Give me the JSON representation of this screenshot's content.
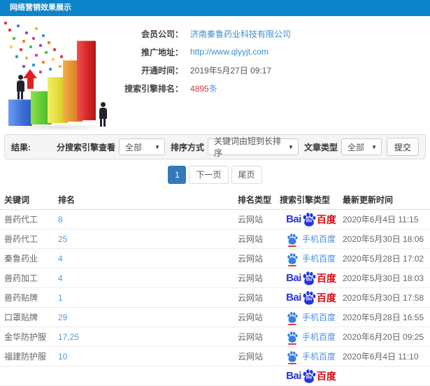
{
  "window": {
    "title": "网络营销效果展示"
  },
  "info": {
    "rows": [
      {
        "label": "会员公司：",
        "value": "济南秦鲁药业科技有限公司",
        "style": "link"
      },
      {
        "label": "推广地址：",
        "value": "http://www.qlyyjt.com",
        "style": "link"
      },
      {
        "label": "开通时间：",
        "value": "2019年5月27日 09:17",
        "style": "text"
      },
      {
        "label": "搜索引擎排名：",
        "value": "4895",
        "suffix": "条",
        "style": "highlight"
      }
    ]
  },
  "filters": {
    "section_label": "结果:",
    "groups": [
      {
        "name": "engine-filter",
        "label": "分搜索引擎查看",
        "value": "全部"
      },
      {
        "name": "sort-order",
        "label": "排序方式",
        "value": "关键词由短到长排序"
      },
      {
        "name": "article-type",
        "label": "文章类型",
        "value": "全部"
      }
    ],
    "submit_label": "提交"
  },
  "pagination": {
    "items": [
      {
        "label": "1",
        "active": true
      },
      {
        "label": "下一页",
        "active": false
      },
      {
        "label": "尾页",
        "active": false
      }
    ]
  },
  "table": {
    "columns": [
      "关键词",
      "排名",
      "排名类型",
      "搜索引擎类型",
      "最新更新时间"
    ],
    "rows": [
      {
        "keyword": "兽药代工",
        "rank": "8",
        "rank_type": "云网站",
        "engine": "baidu",
        "updated": "2020年6月4日 11:15"
      },
      {
        "keyword": "兽药代工",
        "rank": "25",
        "rank_type": "云网站",
        "engine": "mobile",
        "updated": "2020年5月30日 18:06"
      },
      {
        "keyword": "秦鲁药业",
        "rank": "4",
        "rank_type": "云网站",
        "engine": "mobile",
        "updated": "2020年5月28日 17:02"
      },
      {
        "keyword": "兽药加工",
        "rank": "4",
        "rank_type": "云网站",
        "engine": "baidu",
        "updated": "2020年5月30日 18:03"
      },
      {
        "keyword": "兽药贴牌",
        "rank": "1",
        "rank_type": "云网站",
        "engine": "baidu",
        "updated": "2020年5月30日 17:58"
      },
      {
        "keyword": "口罩贴牌",
        "rank": "29",
        "rank_type": "云网站",
        "engine": "mobile",
        "updated": "2020年5月28日 16:55"
      },
      {
        "keyword": "金华防护服",
        "rank": "17,25",
        "rank_type": "云网站",
        "engine": "mobile",
        "updated": "2020年6月20日 09:25"
      },
      {
        "keyword": "福建防护服",
        "rank": "10",
        "rank_type": "云网站",
        "engine": "mobile",
        "updated": "2020年6月4日 11:10"
      },
      {
        "keyword": "",
        "rank": "",
        "rank_type": "",
        "engine": "baidu",
        "updated": "",
        "partial": true
      }
    ]
  },
  "engines": {
    "baidu": {
      "prefix": "Bai",
      "paw_text": "du",
      "suffix": "百度"
    },
    "mobile": {
      "label": "手机百度"
    }
  },
  "colors": {
    "titlebar_blue": "#0b84ca",
    "link_blue": "#3c8dcc",
    "rank_blue": "#4f9be0",
    "count_red": "#e4393c",
    "count_suffix_blue": "#4f9be0",
    "baidu_blue": "#2534dc",
    "baidu_red": "#dd0b12",
    "mobile_baidu_blue": "#4a90e2",
    "pagination_active": "#337ab7"
  }
}
